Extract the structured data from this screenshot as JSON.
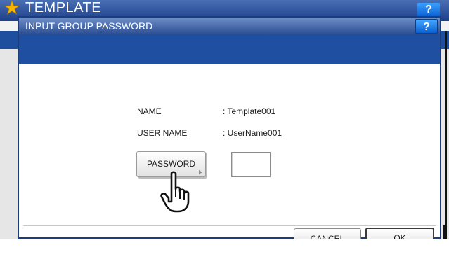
{
  "background_window": {
    "title": "TEMPLATE",
    "help_label": "?"
  },
  "dialog": {
    "title": "INPUT GROUP PASSWORD",
    "help_label": "?",
    "fields": [
      {
        "label": "NAME",
        "value": ": Template001"
      },
      {
        "label": "USER NAME",
        "value": ": UserName001"
      }
    ],
    "password_button_label": "PASSWORD",
    "password_value": "",
    "cancel_label": "CANCEL",
    "ok_label": "OK"
  },
  "colors": {
    "titlebar_blue": "#2b4d92",
    "band_blue": "#1f4fa1",
    "help_blue": "#0a5fd0",
    "star_yellow": "#f4b400"
  },
  "icons": {
    "star": "star-icon",
    "cursor": "hand-pointer-icon",
    "button_arrow": "triangle-right-icon"
  }
}
